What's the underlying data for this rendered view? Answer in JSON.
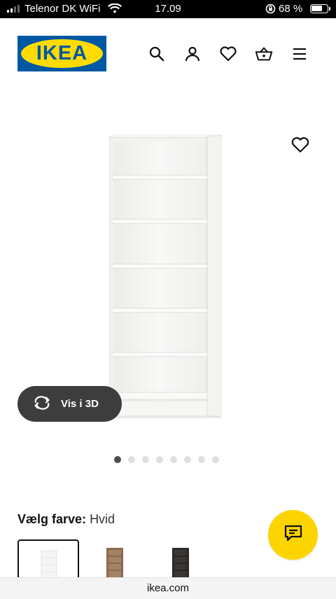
{
  "status_bar": {
    "carrier": "Telenor DK WiFi",
    "time": "17.09",
    "battery_percent": "68 %",
    "battery_level": 0.68
  },
  "header": {
    "logo_text": "IKEA",
    "icons": [
      "search-icon",
      "user-icon",
      "heart-icon",
      "basket-icon",
      "menu-icon"
    ]
  },
  "product": {
    "view_3d_label": "Vis i 3D",
    "image_count": 8,
    "active_image_index": 0
  },
  "color": {
    "label": "Vælg farve:",
    "selected": "Hvid",
    "swatch_colors": [
      "#f4f4f2",
      "#8b6a4e",
      "#2b2826"
    ]
  },
  "url": "ikea.com",
  "colors": {
    "ikea_blue": "#0058a3",
    "ikea_yellow": "#ffdb00",
    "chat_yellow": "#fcd501",
    "pill_bg": "#3d3d3d"
  }
}
